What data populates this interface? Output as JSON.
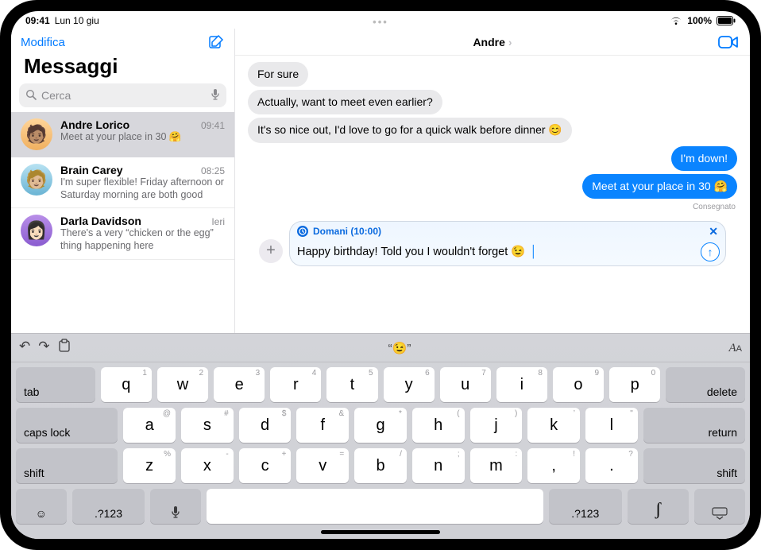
{
  "status": {
    "time": "09:41",
    "date": "Lun 10 giu",
    "battery": "100%"
  },
  "sidebar": {
    "edit": "Modifica",
    "title": "Messaggi",
    "search_placeholder": "Cerca",
    "items": [
      {
        "name": "Andre Lorico",
        "time": "09:41",
        "preview": "Meet at your place in 30 🤗"
      },
      {
        "name": "Brain Carey",
        "time": "08:25",
        "preview": "I'm super flexible! Friday afternoon or Saturday morning are both good"
      },
      {
        "name": "Darla Davidson",
        "time": "Ieri",
        "preview": "There's a very “chicken or the egg” thing happening here"
      }
    ]
  },
  "chat": {
    "contact": "Andre",
    "messages": [
      {
        "dir": "in",
        "text": "For sure"
      },
      {
        "dir": "in",
        "text": "Actually, want to meet even earlier?"
      },
      {
        "dir": "in",
        "text": "It's so nice out, I'd love to go for a quick walk before dinner 😊"
      },
      {
        "dir": "out",
        "text": "I'm down!"
      },
      {
        "dir": "out",
        "text": "Meet at your place in 30 🤗"
      }
    ],
    "delivered": "Consegnato",
    "schedule_label": "Domani (10:00)",
    "draft": "Happy birthday! Told you I wouldn't forget 😉"
  },
  "keyboard": {
    "prediction": "“😉”",
    "tab": "tab",
    "caps": "caps lock",
    "shift": "shift",
    "delete": "delete",
    "return": "return",
    "numswitch": ".?123",
    "row1": [
      {
        "m": "q",
        "a": "1"
      },
      {
        "m": "w",
        "a": "2"
      },
      {
        "m": "e",
        "a": "3"
      },
      {
        "m": "r",
        "a": "4"
      },
      {
        "m": "t",
        "a": "5"
      },
      {
        "m": "y",
        "a": "6"
      },
      {
        "m": "u",
        "a": "7"
      },
      {
        "m": "i",
        "a": "8"
      },
      {
        "m": "o",
        "a": "9"
      },
      {
        "m": "p",
        "a": "0"
      }
    ],
    "row2": [
      {
        "m": "a",
        "a": "@"
      },
      {
        "m": "s",
        "a": "#"
      },
      {
        "m": "d",
        "a": "$"
      },
      {
        "m": "f",
        "a": "&"
      },
      {
        "m": "g",
        "a": "*"
      },
      {
        "m": "h",
        "a": "("
      },
      {
        "m": "j",
        "a": ")"
      },
      {
        "m": "k",
        "a": "’"
      },
      {
        "m": "l",
        "a": "\""
      }
    ],
    "row3": [
      {
        "m": "z",
        "a": "%"
      },
      {
        "m": "x",
        "a": "-"
      },
      {
        "m": "c",
        "a": "+"
      },
      {
        "m": "v",
        "a": "="
      },
      {
        "m": "b",
        "a": "/"
      },
      {
        "m": "n",
        "a": ";"
      },
      {
        "m": "m",
        "a": ":"
      },
      {
        "m": ",",
        "a": "!"
      },
      {
        "m": ".",
        "a": "?"
      }
    ]
  }
}
